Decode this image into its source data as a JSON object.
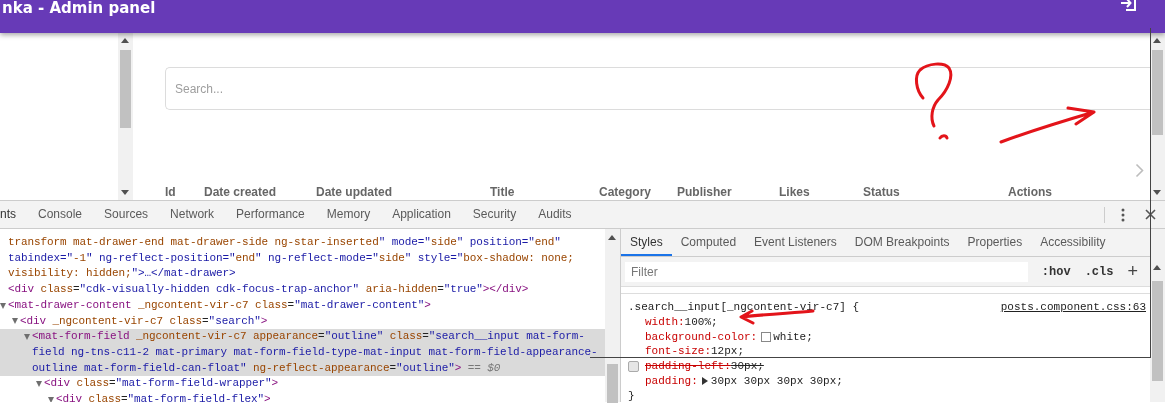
{
  "app_bar": {
    "title": "nka - Admin panel"
  },
  "search": {
    "placeholder": "Search..."
  },
  "table": {
    "columns": [
      "Id",
      "Date created",
      "Date updated",
      "Title",
      "Category",
      "Publisher",
      "Likes",
      "Status",
      "Actions"
    ]
  },
  "devtools": {
    "tabs": [
      {
        "label": "nts",
        "selected": true
      },
      {
        "label": "Console",
        "selected": false
      },
      {
        "label": "Sources",
        "selected": false
      },
      {
        "label": "Network",
        "selected": false
      },
      {
        "label": "Performance",
        "selected": false
      },
      {
        "label": "Memory",
        "selected": false
      },
      {
        "label": "Application",
        "selected": false
      },
      {
        "label": "Security",
        "selected": false
      },
      {
        "label": "Audits",
        "selected": false
      }
    ],
    "elements": [
      {
        "lines": [
          "transform mat-drawer-end mat-drawer-side ng-star-inserted\" mode=\"side\" position=\"end\"",
          "tabindex=\"-1\" ng-reflect-position=\"end\" ng-reflect-mode=\"side\" style=\"box-shadow: none;",
          "visibility: hidden;\">…</mat-drawer>"
        ],
        "selected": false
      },
      {
        "lines": [
          "<div class=\"cdk-visually-hidden cdk-focus-trap-anchor\" aria-hidden=\"true\"></div>"
        ],
        "selected": false
      },
      {
        "lines": [
          "<mat-drawer-content _ngcontent-vir-c7 class=\"mat-drawer-content\">"
        ],
        "selected": false,
        "expanded": true,
        "children": [
          {
            "lines": [
              "<div _ngcontent-vir-c7 class=\"search\">"
            ],
            "selected": false,
            "expanded": true,
            "children": [
              {
                "lines": [
                  "<mat-form-field _ngcontent-vir-c7 appearance=\"outline\" class=\"search__input mat-form-",
                  "field ng-tns-c11-2 mat-primary mat-form-field-type-mat-input mat-form-field-appearance-",
                  "outline mat-form-field-can-float\" ng-reflect-appearance=\"outline\">"
                ],
                "selected": true,
                "expanded": true,
                "console_ref": "== $0",
                "children": [
                  {
                    "lines": [
                      "<div class=\"mat-form-field-wrapper\">"
                    ],
                    "selected": false,
                    "expanded": true,
                    "children": [
                      {
                        "lines": [
                          "<div class=\"mat-form-field-flex\">"
                        ],
                        "selected": false,
                        "expanded": true
                      }
                    ]
                  }
                ]
              }
            ]
          }
        ]
      }
    ],
    "styles_tabs": [
      {
        "label": "Styles",
        "selected": true
      },
      {
        "label": "Computed",
        "selected": false
      },
      {
        "label": "Event Listeners",
        "selected": false
      },
      {
        "label": "DOM Breakpoints",
        "selected": false
      },
      {
        "label": "Properties",
        "selected": false
      },
      {
        "label": "Accessibility",
        "selected": false
      }
    ],
    "filter": {
      "placeholder": "Filter"
    },
    "filter_tools": [
      ":hov",
      ".cls",
      "+"
    ],
    "rule": {
      "selector": ".search__input[_ngcontent-vir-c7] {",
      "source": "posts.component.css:63",
      "close": "}",
      "declarations": [
        {
          "kind": "plain",
          "property": "width:",
          "value": "100%;",
          "enabled": true
        },
        {
          "kind": "color",
          "property": "background-color:",
          "value": "white;",
          "enabled": true,
          "color": "#ffffff"
        },
        {
          "kind": "plain",
          "property": "font-size:",
          "value": "12px;",
          "enabled": true
        },
        {
          "kind": "plain",
          "property": "padding-left:",
          "value": "30px;",
          "enabled": false
        },
        {
          "kind": "shorthand",
          "property": "padding:",
          "value": "30px 30px 30px 30px;",
          "enabled": true
        }
      ]
    }
  }
}
